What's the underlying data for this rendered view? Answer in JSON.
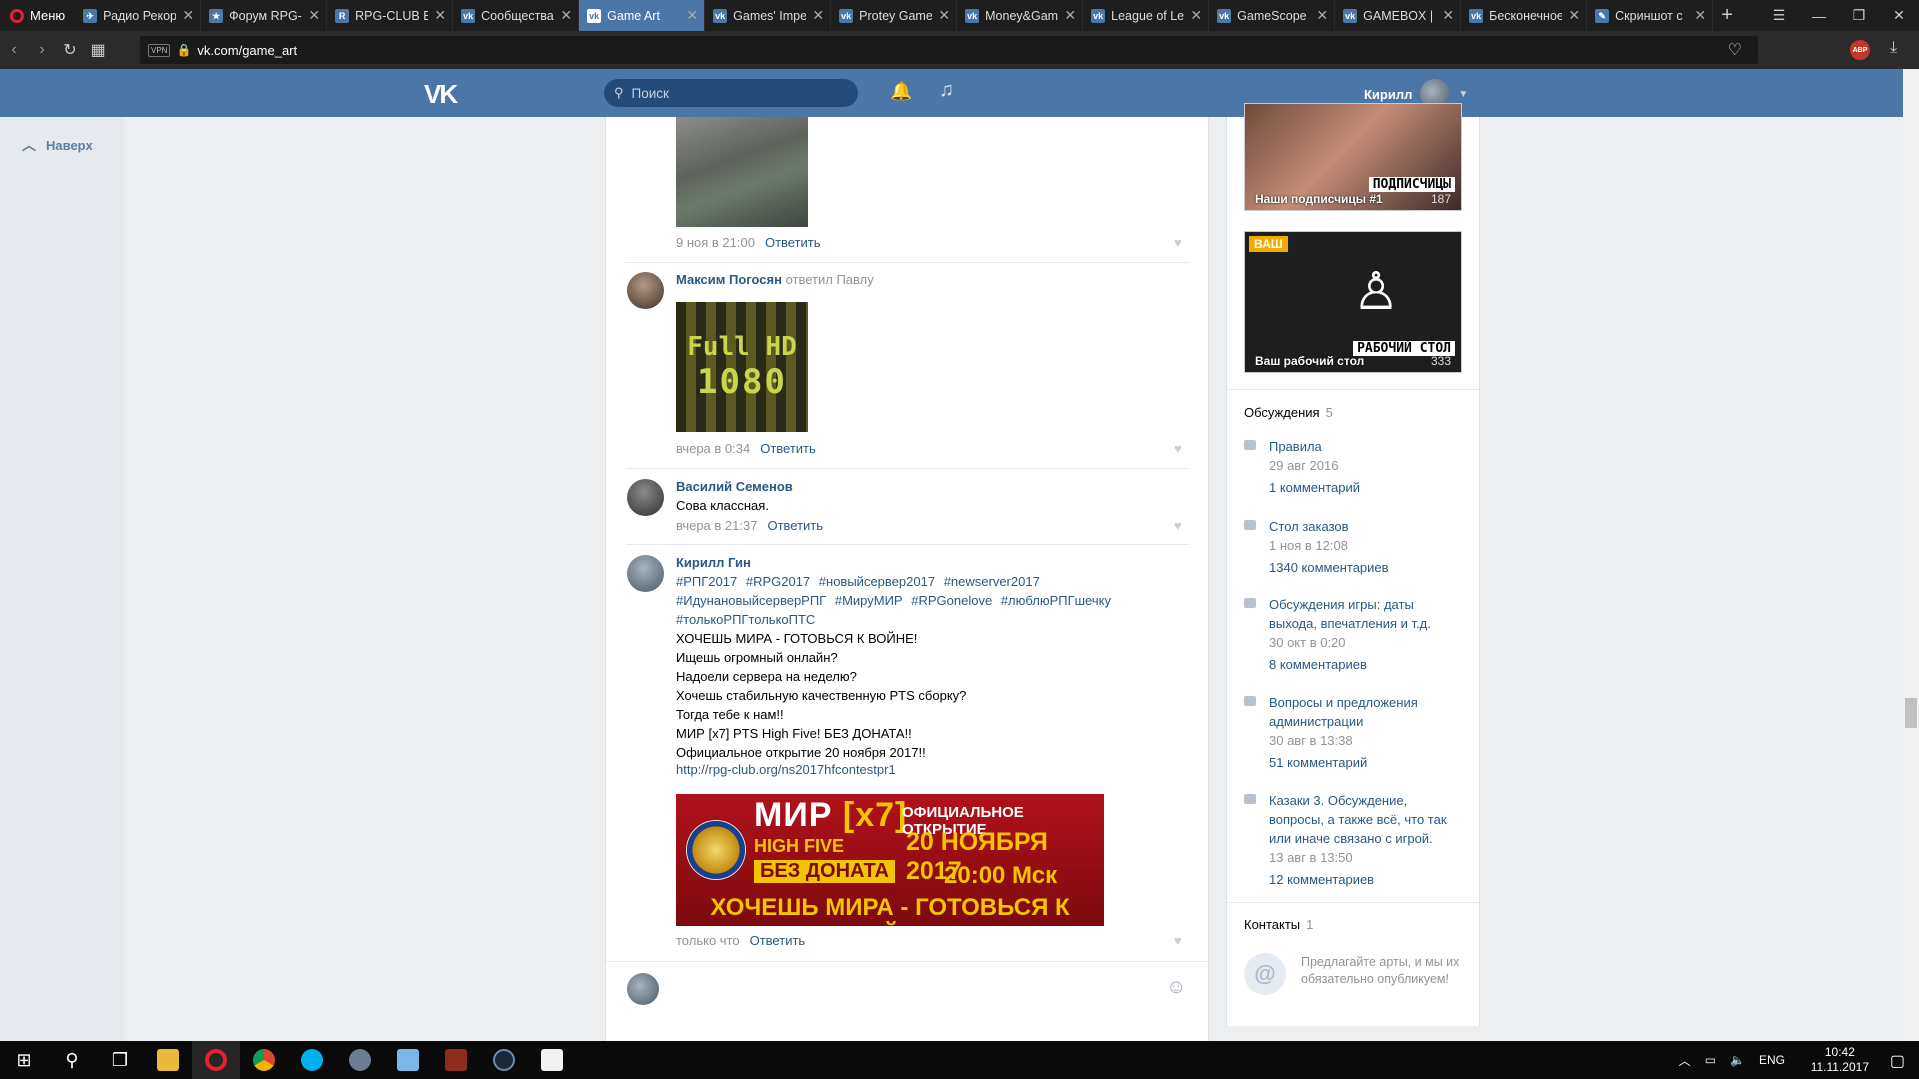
{
  "browser": {
    "menu_label": "Меню",
    "tabs": [
      {
        "label": "Радио Рекорд",
        "fav": "✈"
      },
      {
        "label": "Форум RPG-Club",
        "fav": "★"
      },
      {
        "label": "RPG-CLUB Ev",
        "fav": "R"
      },
      {
        "label": "Сообщества",
        "fav": "vk"
      },
      {
        "label": "Game Art",
        "fav": "vk"
      },
      {
        "label": "Games' Imperium",
        "fav": "vk"
      },
      {
        "label": "Protey Games",
        "fav": "vk"
      },
      {
        "label": "Money&Games",
        "fav": "vk"
      },
      {
        "label": "League of Legends",
        "fav": "vk"
      },
      {
        "label": "GameScope",
        "fav": "vk"
      },
      {
        "label": "GAMEBOX | I",
        "fav": "vk"
      },
      {
        "label": "Бесконечное",
        "fav": "vk"
      },
      {
        "label": "Скриншот с",
        "fav": "✎"
      }
    ],
    "active_tab_index": 4,
    "new_tab_label": "+",
    "vpn_label": "VPN",
    "url": "vk.com/game_art",
    "abp_label": "ABP",
    "abp_count": "2"
  },
  "vk": {
    "search_placeholder": "Поиск",
    "user_name": "Кирилл",
    "back_to_top": "Наверх"
  },
  "comments": [
    {
      "meta_time": "9 ноя в 21:00",
      "reply": "Ответить"
    },
    {
      "author": "Максим Погосян",
      "answered": "ответил Павлу",
      "image_text": [
        "Full HD",
        "1080"
      ],
      "meta_time": "вчера в 0:34",
      "reply": "Ответить"
    },
    {
      "author": "Василий Семенов",
      "text": "Сова классная.",
      "meta_time": "вчера в 21:37",
      "reply": "Ответить"
    },
    {
      "author": "Кирилл Гин",
      "hashtags": [
        "#РПГ2017",
        "#RPG2017",
        "#новыйсервер2017",
        "#newserver2017",
        "#ИдунановыйсерверРПГ",
        "#МируМИР",
        "#RPGonelove",
        "#люблюРПГшечку",
        "#толькоРПГтолькоПТС"
      ],
      "lines": [
        "ХОЧЕШЬ МИРА - ГОТОВЬСЯ К ВОЙНЕ!",
        "Ищешь огромный онлайн?",
        "Надоели сервера на неделю?",
        "Хочешь стабильную качественную PTS сборку?",
        "Тогда тебе к нам!!",
        "МИР [x7] PTS High Five! БЕЗ ДОНАТА!!",
        "Официальное открытие 20 ноября 2017!!"
      ],
      "link": "http://rpg-club.org/ns2017hfcontestpr1",
      "banner": {
        "mir": "МИР",
        "x7": "[x7]",
        "high_five": "HIGH FIVE",
        "no_donate": "БЕЗ ДОНАТА",
        "opening": "ОФИЦИАЛЬНОЕ ОТКРЫТИЕ",
        "date": "20 НОЯБРЯ 2017",
        "time": "20:00 Мск",
        "war": "ХОЧЕШЬ МИРА - ГОТОВЬСЯ К ВОЙНЕ"
      },
      "meta_time": "только что",
      "reply": "Ответить"
    }
  ],
  "sidebar": {
    "albums": [
      {
        "title": "Наши подписчицы #1",
        "count": "187",
        "stamp": "ПОДПИСЧИЦЫ"
      },
      {
        "title": "Ваш рабочий стол",
        "count": "333",
        "stamp": "РАБОЧИЙ СТОЛ",
        "badge": "ВАШ"
      }
    ],
    "discussions_label": "Обсуждения",
    "discussions_count": "5",
    "topics": [
      {
        "title": "Правила",
        "date": "29 авг 2016",
        "count": "1 комментарий"
      },
      {
        "title": "Стол заказов",
        "date": "1 ноя в 12:08",
        "count": "1340 комментариев"
      },
      {
        "title": "Обсуждения игры: даты выхода, впечатления и т.д.",
        "date": "30 окт в 0:20",
        "count": "8 комментариев"
      },
      {
        "title": "Вопросы и предложения администрации",
        "date": "30 авг в 13:38",
        "count": "51 комментарий"
      },
      {
        "title": "Казаки 3. Обсуждение, вопросы, а также всё, что так или иначе связано с игрой.",
        "date": "13 авг в 13:50",
        "count": "12 комментариев"
      }
    ],
    "contacts_label": "Контакты",
    "contacts_count": "1",
    "contacts_text": "Предлагайте арты, и мы их обязательно опубликуем!"
  },
  "taskbar": {
    "lang": "ENG",
    "time": "10:42",
    "date": "11.11.2017"
  }
}
